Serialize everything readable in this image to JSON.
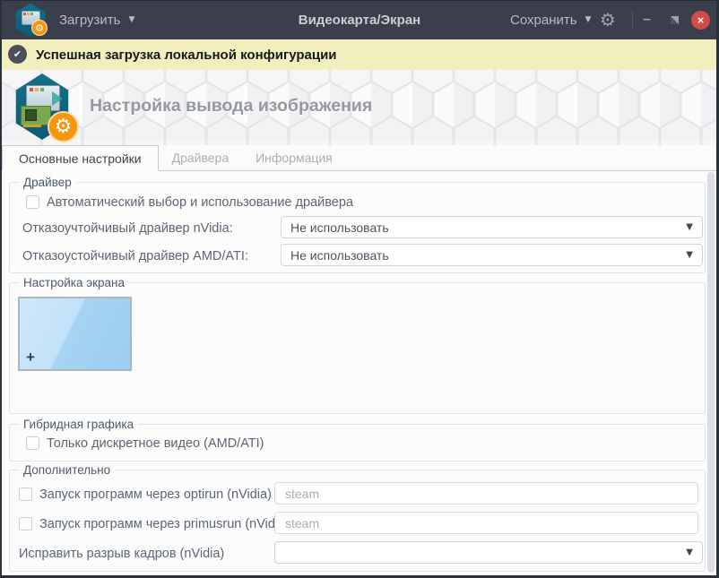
{
  "titlebar": {
    "load_label": "Загрузить",
    "title": "Видеокарта/Экран",
    "save_label": "Сохранить"
  },
  "notification": {
    "message": "Успешная загрузка локальной конфигурации"
  },
  "banner": {
    "title": "Настройка вывода изображения"
  },
  "tabs": [
    {
      "label": "Основные настройки",
      "active": true
    },
    {
      "label": "Драйвера",
      "active": false
    },
    {
      "label": "Информация",
      "active": false
    }
  ],
  "groups": {
    "driver": {
      "legend": "Драйвер",
      "auto_label": "Автоматический выбор и использование драйвера",
      "auto_checked": false,
      "nvidia_label": "Отказоучтойчивый драйвер nVidia:",
      "nvidia_value": "Не использовать",
      "amd_label": "Отказоустойчивый драйвер AMD/ATI:",
      "amd_value": "Не использовать"
    },
    "screen": {
      "legend": "Настройка экрана",
      "add_label": "+"
    },
    "hybrid": {
      "legend": "Гибридная графика",
      "discrete_label": "Только дискретное видео (AMD/ATI)",
      "discrete_checked": false
    },
    "extra": {
      "legend": "Дополнительно",
      "optirun_label": "Запуск программ через optirun (nVidia)",
      "optirun_checked": false,
      "optirun_placeholder": "steam",
      "primusrun_label": "Запуск программ через primusrun (nVidia)",
      "primusrun_checked": false,
      "primusrun_placeholder": "steam",
      "tearing_label": "Исправить разрыв кадров (nVidia)",
      "tearing_value": ""
    }
  },
  "icons": {
    "caret": "▼",
    "gear": "⚙",
    "check": "✔",
    "minimize": "–",
    "close": "×"
  },
  "colors": {
    "titlebar_bg": "#3a3f4b",
    "notification_bg": "#f2efbf",
    "close_red": "#d24b47",
    "gear_orange": "#f5960f",
    "hexagon_teal": "#11677e",
    "screen_preview_blue": "#aed7f4"
  }
}
